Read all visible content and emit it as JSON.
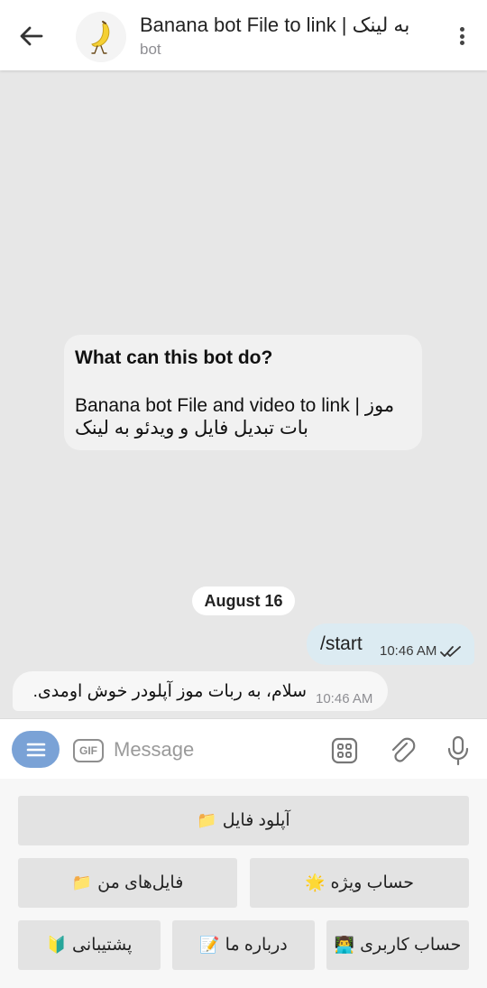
{
  "header": {
    "title": "Banana bot File to link | به لینک",
    "subtitle": "bot"
  },
  "chat": {
    "info_card": {
      "title": "What can this bot do?",
      "line1": "Banana bot File and video to link | موز",
      "line2": "بات تبدیل فایل و ویدئو به لینک"
    },
    "date_chip": "August 16",
    "messages": [
      {
        "direction": "out",
        "text": "/start",
        "time": "10:46 AM",
        "status": "read"
      },
      {
        "direction": "in",
        "text": "سلام، به ربات موز آپلودر خوش اومدی.",
        "time": "10:46 AM"
      }
    ]
  },
  "input_bar": {
    "placeholder": "Message",
    "gif_label": "GIF"
  },
  "keyboard": {
    "rows": [
      [
        {
          "label": "آپلود فایل",
          "icon": "📁"
        }
      ],
      [
        {
          "label": "حساب ویژه",
          "icon": "🌟"
        },
        {
          "label": "فایل‌های من",
          "icon": "📁"
        }
      ],
      [
        {
          "label": "حساب کاربری",
          "icon": "👨‍💻"
        },
        {
          "label": "درباره ما",
          "icon": "📝"
        },
        {
          "label": "پشتیبانی",
          "icon": "🔰"
        }
      ]
    ]
  },
  "colors": {
    "chat_background": "#e7e7e7",
    "outgoing_bubble": "#dcebf2",
    "accent": "#7aa2d6"
  }
}
